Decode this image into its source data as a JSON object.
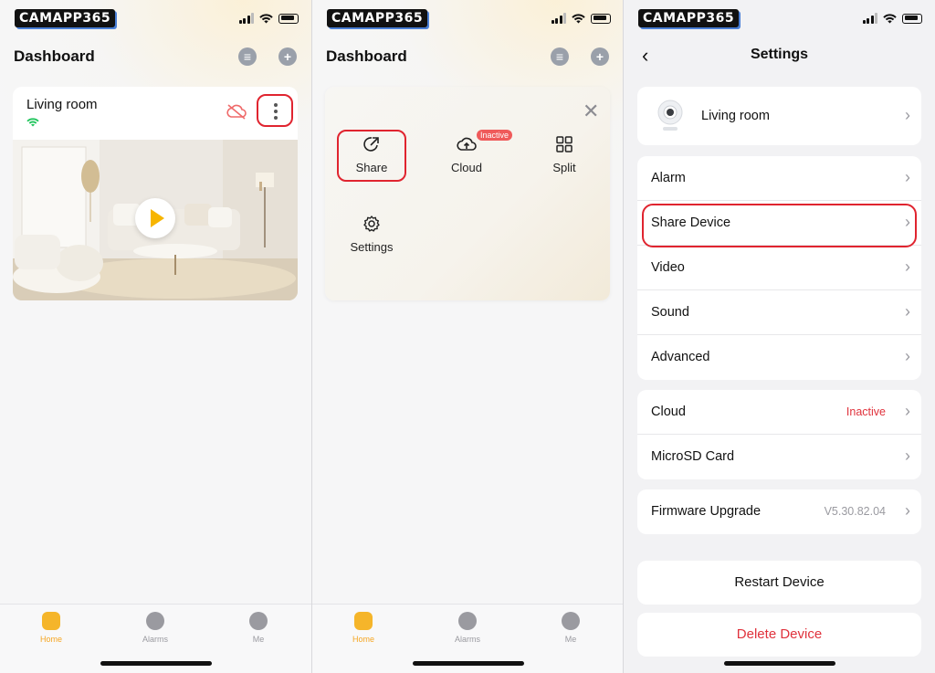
{
  "brand": {
    "logo": "CAMAPP365",
    "logo_shadow": "#4a7fd6"
  },
  "colors": {
    "accent": "#f5a623",
    "danger": "#e0323c",
    "highlight": "#e0242f",
    "online": "#22c55e"
  },
  "panel1": {
    "title": "Dashboard",
    "header_icons": [
      "message-icon",
      "add-icon"
    ],
    "device": {
      "name": "Living room",
      "status_icons": [
        "wifi-icon",
        "cloud-off-icon",
        "more-vert-icon",
        "play-icon"
      ]
    }
  },
  "panel2": {
    "title": "Dashboard",
    "menu": {
      "share": "Share",
      "cloud": "Cloud",
      "cloud_badge": "Inactive",
      "split": "Split",
      "settings": "Settings"
    }
  },
  "panel3": {
    "title": "Settings",
    "device_name": "Living room",
    "rows_group1": [
      "Alarm",
      "Share Device",
      "Video",
      "Sound",
      "Advanced"
    ],
    "cloud_label": "Cloud",
    "cloud_value": "Inactive",
    "microsd_label": "MicroSD Card",
    "firmware_label": "Firmware Upgrade",
    "firmware_value": "V5.30.82.04",
    "restart": "Restart Device",
    "delete": "Delete Device"
  },
  "tabbar": {
    "home": "Home",
    "alarms": "Alarms",
    "me": "Me"
  }
}
